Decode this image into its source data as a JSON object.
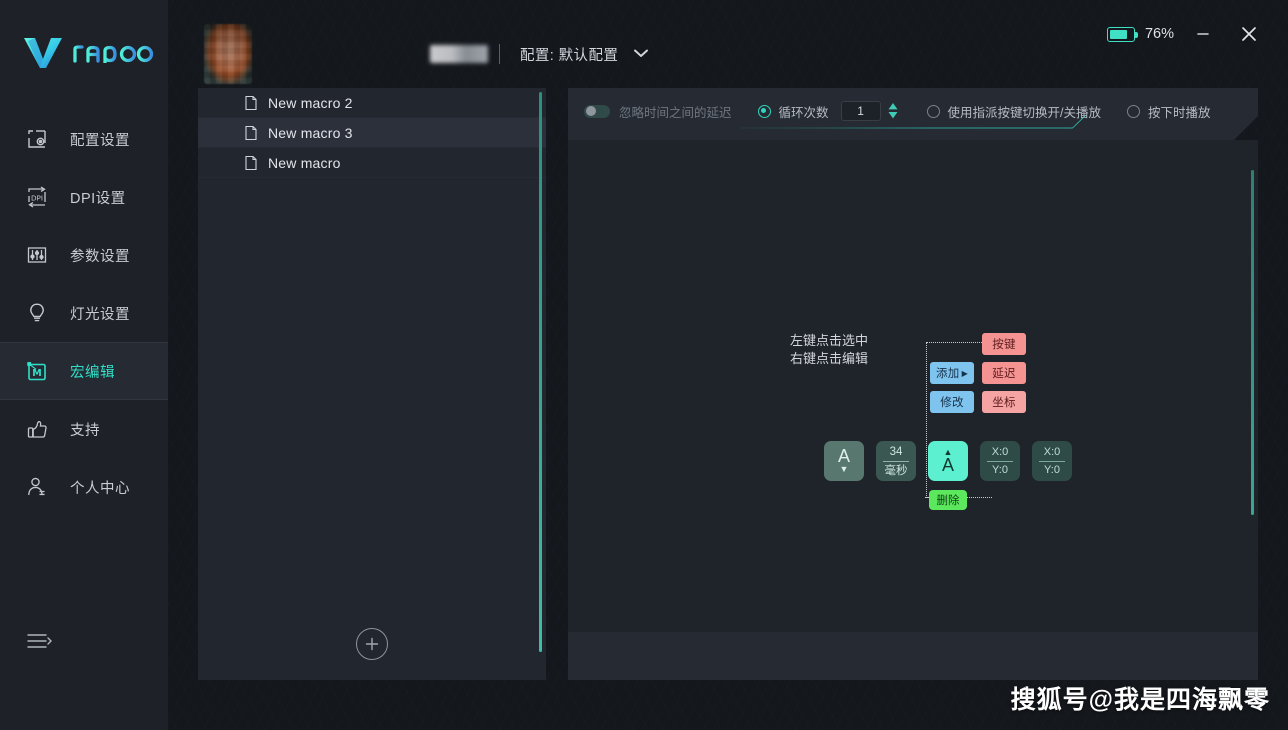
{
  "brand": {
    "name": "rapoo",
    "logo_icon": "rapoo-v-logo"
  },
  "sidebar": {
    "items": [
      {
        "label": "配置设置",
        "icon": "profile-settings-icon",
        "active": false
      },
      {
        "label": "DPI设置",
        "icon": "dpi-settings-icon",
        "active": false
      },
      {
        "label": "参数设置",
        "icon": "parameter-settings-icon",
        "active": false
      },
      {
        "label": "灯光设置",
        "icon": "light-settings-icon",
        "active": false
      },
      {
        "label": "宏编辑",
        "icon": "macro-editor-icon",
        "active": true
      },
      {
        "label": "支持",
        "icon": "thumbs-up-icon",
        "active": false
      },
      {
        "label": "个人中心",
        "icon": "user-account-icon",
        "active": false
      }
    ],
    "collapse_icon": "collapse-menu-icon"
  },
  "titlebar": {
    "device_avatar": "device-thumbnail",
    "device_name": "",
    "separator": "|",
    "profile_label": "配置: 默认配置",
    "profile_chevron": "chevron-down-icon",
    "battery": {
      "icon": "battery-icon",
      "percent_label": "76%",
      "level": 76
    },
    "minimize_label": "—",
    "close_label": "✕"
  },
  "macro_list": {
    "items": [
      {
        "name": "New macro 2",
        "icon": "document-icon",
        "hover": false
      },
      {
        "name": "New macro 3",
        "icon": "document-icon",
        "hover": true
      },
      {
        "name": "New macro",
        "icon": "document-icon",
        "hover": false
      }
    ],
    "add_button": {
      "icon": "plus-circle-icon",
      "label": ""
    },
    "scrollbar": "vertical-scrollbar"
  },
  "editor": {
    "toolbar": {
      "ignore_delay": {
        "label": "忽略时间之间的延迟",
        "enabled": false,
        "toggle_icon": "toggle-switch-off"
      },
      "loop_count": {
        "label": "循环次数",
        "selected": true,
        "value": "1",
        "spinner_icon": "spinner-updown-icon"
      },
      "toggle_key_play": {
        "label": "使用指派按键切换开/关播放",
        "selected": false
      },
      "play_on_press": {
        "label": "按下时播放",
        "selected": false
      }
    },
    "hint": {
      "line1": "左键点击选中",
      "line2": "右键点击编辑"
    },
    "context_menu": {
      "primary": [
        {
          "label": "添加",
          "arrow": "▶",
          "color": "#7ec4ef"
        },
        {
          "label": "修改",
          "arrow": "",
          "color": "#7ec4ef"
        }
      ],
      "submenu": [
        {
          "label": "按键",
          "color": "#f59393"
        },
        {
          "label": "延迟",
          "color": "#f59393"
        },
        {
          "label": "坐标",
          "color": "#f5a3a3"
        }
      ]
    },
    "sequence": [
      {
        "type": "key",
        "label": "A",
        "arrow": "▼",
        "selected": false,
        "name": "key-up-node"
      },
      {
        "type": "delay",
        "top": "34",
        "bottom": "毫秒",
        "selected": false,
        "name": "delay-node"
      },
      {
        "type": "key",
        "label": "A",
        "arrow": "▲",
        "selected": true,
        "name": "key-down-node"
      },
      {
        "type": "coord",
        "top": "X:0",
        "bottom": "Y:0",
        "selected": false,
        "name": "coordinate-node"
      },
      {
        "type": "coord",
        "top": "X:0",
        "bottom": "Y:0",
        "selected": false,
        "name": "coordinate-node"
      }
    ],
    "delete_button": {
      "label": "删除",
      "color": "#5ce85c"
    },
    "scrollbar": "vertical-scrollbar"
  },
  "watermark": {
    "text": "搜狐号@我是四海飘零"
  },
  "colors": {
    "accent": "#2fd6bd",
    "sidebar_bg": "#1e2127",
    "panel_bg": "#22262e",
    "selected_node": "#5df0d0",
    "delete_green": "#5ce85c",
    "menu_blue": "#7ec4ef",
    "menu_red": "#f59393"
  }
}
